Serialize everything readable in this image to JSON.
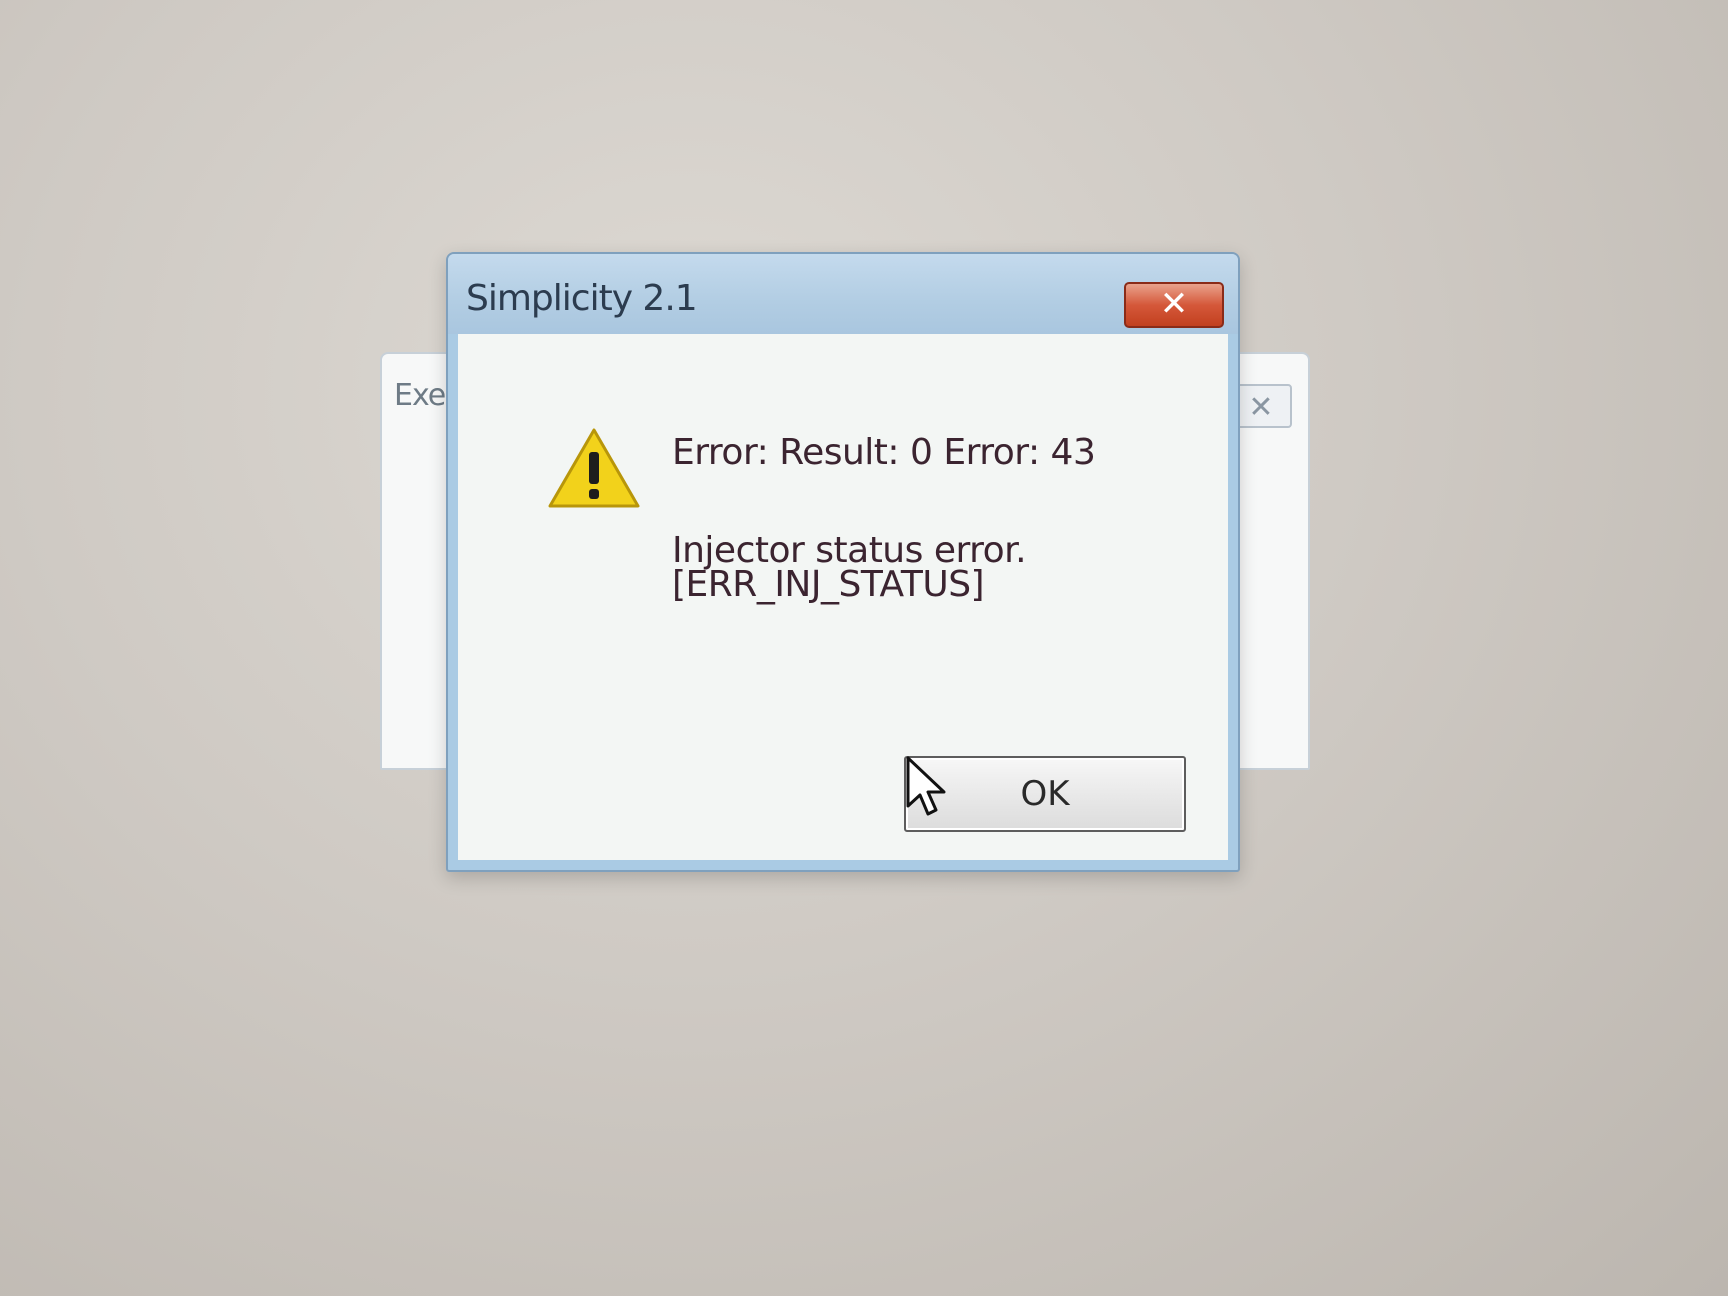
{
  "background_window": {
    "title_partial": "Exe",
    "close_glyph": "✕"
  },
  "dialog": {
    "title": "Simplicity 2.1",
    "close_glyph": "✕",
    "icon": "warning-triangle-icon",
    "message_line1": "Error: Result: 0   Error: 43",
    "message_line2": "Injector status error.",
    "message_line3": "[ERR_INJ_STATUS]",
    "ok_label": "OK"
  },
  "colors": {
    "title_bar": "#b2cde3",
    "close_button": "#d5583a",
    "warning_fill": "#f2d21b",
    "message_text": "#3b2430"
  }
}
